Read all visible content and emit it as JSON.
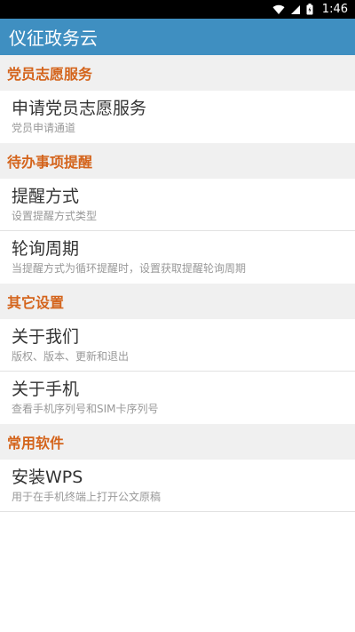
{
  "status_bar": {
    "time": "1:46",
    "icons": [
      "wifi-icon",
      "signal-icon",
      "battery-icon"
    ]
  },
  "app_bar": {
    "title": "仪征政务云"
  },
  "colors": {
    "app_bar": "#3f8fc1",
    "section_text": "#d4641c",
    "section_bg": "#f0f0f0"
  },
  "sections": [
    {
      "title": "党员志愿服务",
      "items": [
        {
          "title": "申请党员志愿服务",
          "subtitle": "党员申请通道"
        }
      ]
    },
    {
      "title": "待办事项提醒",
      "items": [
        {
          "title": "提醒方式",
          "subtitle": "设置提醒方式类型"
        },
        {
          "title": "轮询周期",
          "subtitle": "当提醒方式为循环提醒时，设置获取提醒轮询周期"
        }
      ]
    },
    {
      "title": "其它设置",
      "items": [
        {
          "title": "关于我们",
          "subtitle": "版权、版本、更新和退出"
        },
        {
          "title": "关于手机",
          "subtitle": "查看手机序列号和SIM卡序列号"
        }
      ]
    },
    {
      "title": "常用软件",
      "items": [
        {
          "title": "安装WPS",
          "subtitle": "用于在手机终端上打开公文原稿"
        }
      ]
    }
  ]
}
